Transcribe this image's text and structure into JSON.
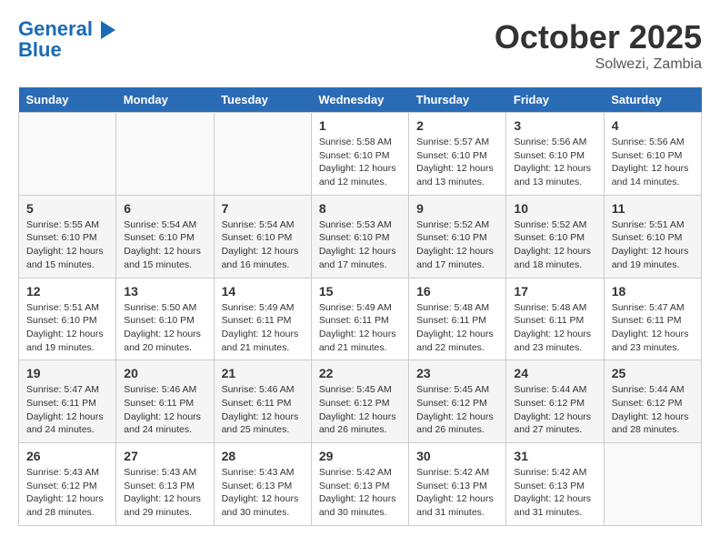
{
  "header": {
    "logo_line1": "General",
    "logo_line2": "Blue",
    "month": "October 2025",
    "location": "Solwezi, Zambia"
  },
  "weekdays": [
    "Sunday",
    "Monday",
    "Tuesday",
    "Wednesday",
    "Thursday",
    "Friday",
    "Saturday"
  ],
  "weeks": [
    [
      {
        "day": "",
        "info": ""
      },
      {
        "day": "",
        "info": ""
      },
      {
        "day": "",
        "info": ""
      },
      {
        "day": "1",
        "info": "Sunrise: 5:58 AM\nSunset: 6:10 PM\nDaylight: 12 hours\nand 12 minutes."
      },
      {
        "day": "2",
        "info": "Sunrise: 5:57 AM\nSunset: 6:10 PM\nDaylight: 12 hours\nand 13 minutes."
      },
      {
        "day": "3",
        "info": "Sunrise: 5:56 AM\nSunset: 6:10 PM\nDaylight: 12 hours\nand 13 minutes."
      },
      {
        "day": "4",
        "info": "Sunrise: 5:56 AM\nSunset: 6:10 PM\nDaylight: 12 hours\nand 14 minutes."
      }
    ],
    [
      {
        "day": "5",
        "info": "Sunrise: 5:55 AM\nSunset: 6:10 PM\nDaylight: 12 hours\nand 15 minutes."
      },
      {
        "day": "6",
        "info": "Sunrise: 5:54 AM\nSunset: 6:10 PM\nDaylight: 12 hours\nand 15 minutes."
      },
      {
        "day": "7",
        "info": "Sunrise: 5:54 AM\nSunset: 6:10 PM\nDaylight: 12 hours\nand 16 minutes."
      },
      {
        "day": "8",
        "info": "Sunrise: 5:53 AM\nSunset: 6:10 PM\nDaylight: 12 hours\nand 17 minutes."
      },
      {
        "day": "9",
        "info": "Sunrise: 5:52 AM\nSunset: 6:10 PM\nDaylight: 12 hours\nand 17 minutes."
      },
      {
        "day": "10",
        "info": "Sunrise: 5:52 AM\nSunset: 6:10 PM\nDaylight: 12 hours\nand 18 minutes."
      },
      {
        "day": "11",
        "info": "Sunrise: 5:51 AM\nSunset: 6:10 PM\nDaylight: 12 hours\nand 19 minutes."
      }
    ],
    [
      {
        "day": "12",
        "info": "Sunrise: 5:51 AM\nSunset: 6:10 PM\nDaylight: 12 hours\nand 19 minutes."
      },
      {
        "day": "13",
        "info": "Sunrise: 5:50 AM\nSunset: 6:10 PM\nDaylight: 12 hours\nand 20 minutes."
      },
      {
        "day": "14",
        "info": "Sunrise: 5:49 AM\nSunset: 6:11 PM\nDaylight: 12 hours\nand 21 minutes."
      },
      {
        "day": "15",
        "info": "Sunrise: 5:49 AM\nSunset: 6:11 PM\nDaylight: 12 hours\nand 21 minutes."
      },
      {
        "day": "16",
        "info": "Sunrise: 5:48 AM\nSunset: 6:11 PM\nDaylight: 12 hours\nand 22 minutes."
      },
      {
        "day": "17",
        "info": "Sunrise: 5:48 AM\nSunset: 6:11 PM\nDaylight: 12 hours\nand 23 minutes."
      },
      {
        "day": "18",
        "info": "Sunrise: 5:47 AM\nSunset: 6:11 PM\nDaylight: 12 hours\nand 23 minutes."
      }
    ],
    [
      {
        "day": "19",
        "info": "Sunrise: 5:47 AM\nSunset: 6:11 PM\nDaylight: 12 hours\nand 24 minutes."
      },
      {
        "day": "20",
        "info": "Sunrise: 5:46 AM\nSunset: 6:11 PM\nDaylight: 12 hours\nand 24 minutes."
      },
      {
        "day": "21",
        "info": "Sunrise: 5:46 AM\nSunset: 6:11 PM\nDaylight: 12 hours\nand 25 minutes."
      },
      {
        "day": "22",
        "info": "Sunrise: 5:45 AM\nSunset: 6:12 PM\nDaylight: 12 hours\nand 26 minutes."
      },
      {
        "day": "23",
        "info": "Sunrise: 5:45 AM\nSunset: 6:12 PM\nDaylight: 12 hours\nand 26 minutes."
      },
      {
        "day": "24",
        "info": "Sunrise: 5:44 AM\nSunset: 6:12 PM\nDaylight: 12 hours\nand 27 minutes."
      },
      {
        "day": "25",
        "info": "Sunrise: 5:44 AM\nSunset: 6:12 PM\nDaylight: 12 hours\nand 28 minutes."
      }
    ],
    [
      {
        "day": "26",
        "info": "Sunrise: 5:43 AM\nSunset: 6:12 PM\nDaylight: 12 hours\nand 28 minutes."
      },
      {
        "day": "27",
        "info": "Sunrise: 5:43 AM\nSunset: 6:13 PM\nDaylight: 12 hours\nand 29 minutes."
      },
      {
        "day": "28",
        "info": "Sunrise: 5:43 AM\nSunset: 6:13 PM\nDaylight: 12 hours\nand 30 minutes."
      },
      {
        "day": "29",
        "info": "Sunrise: 5:42 AM\nSunset: 6:13 PM\nDaylight: 12 hours\nand 30 minutes."
      },
      {
        "day": "30",
        "info": "Sunrise: 5:42 AM\nSunset: 6:13 PM\nDaylight: 12 hours\nand 31 minutes."
      },
      {
        "day": "31",
        "info": "Sunrise: 5:42 AM\nSunset: 6:13 PM\nDaylight: 12 hours\nand 31 minutes."
      },
      {
        "day": "",
        "info": ""
      }
    ]
  ]
}
